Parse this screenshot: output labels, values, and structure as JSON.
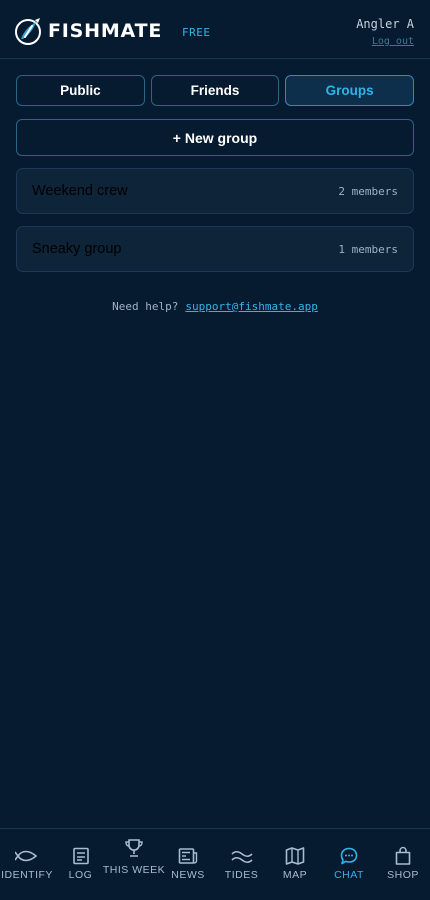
{
  "header": {
    "brand": "FISHMATE",
    "plan": "FREE",
    "user": "Angler A",
    "logout": "Log out"
  },
  "tabs": [
    {
      "label": "Public",
      "active": false
    },
    {
      "label": "Friends",
      "active": false
    },
    {
      "label": "Groups",
      "active": true
    }
  ],
  "new_group_label": "+ New group",
  "groups": [
    {
      "name": "Weekend crew",
      "members": "2 members"
    },
    {
      "name": "Sneaky group",
      "members": "1 members"
    }
  ],
  "help": {
    "text": "Need help?",
    "link": "support@fishmate.app"
  },
  "nav": [
    {
      "label": "IDENTIFY",
      "icon": "fish-icon"
    },
    {
      "label": "LOG",
      "icon": "notebook-icon"
    },
    {
      "label": "THIS WEEK",
      "icon": "trophy-icon"
    },
    {
      "label": "NEWS",
      "icon": "newspaper-icon"
    },
    {
      "label": "TIDES",
      "icon": "waves-icon"
    },
    {
      "label": "MAP",
      "icon": "map-icon"
    },
    {
      "label": "CHAT",
      "icon": "chat-bubble-icon",
      "active": true
    },
    {
      "label": "SHOP",
      "icon": "shopping-bag-icon"
    }
  ],
  "colors": {
    "background": "#071b30",
    "accent": "#30b3e6",
    "card": "#0d2439",
    "border": "#2a6586"
  }
}
